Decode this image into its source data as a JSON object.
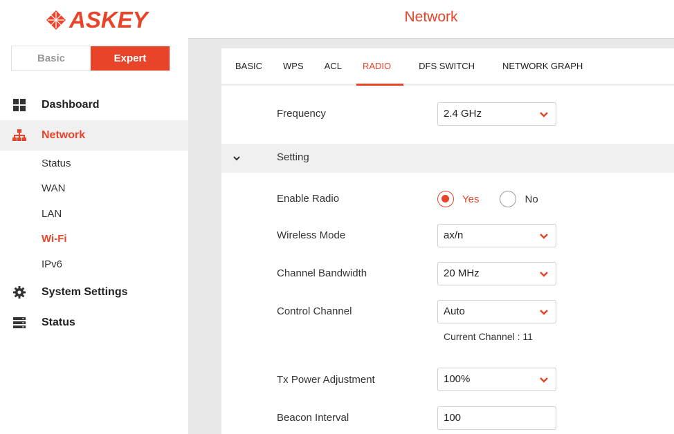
{
  "brand": {
    "name": "ASKEY",
    "color": "#e8442a"
  },
  "header": {
    "title": "Network"
  },
  "mode_toggle": {
    "basic_label": "Basic",
    "expert_label": "Expert",
    "selected": "Expert"
  },
  "sidebar": {
    "items": [
      {
        "label": "Dashboard",
        "icon": "dashboard-grid-icon"
      },
      {
        "label": "Network",
        "icon": "network-icon",
        "active": true
      },
      {
        "label": "System Settings",
        "icon": "gear-icon"
      },
      {
        "label": "Status",
        "icon": "server-icon"
      }
    ],
    "network_sub": [
      {
        "label": "Status"
      },
      {
        "label": "WAN"
      },
      {
        "label": "LAN"
      },
      {
        "label": "Wi-Fi",
        "active": true
      },
      {
        "label": "IPv6"
      }
    ]
  },
  "tabs": [
    {
      "label": "BASIC"
    },
    {
      "label": "WPS"
    },
    {
      "label": "ACL"
    },
    {
      "label": "RADIO",
      "active": true
    },
    {
      "label": "DFS SWITCH"
    },
    {
      "label": "NETWORK GRAPH"
    }
  ],
  "form": {
    "frequency": {
      "label": "Frequency",
      "value": "2.4 GHz"
    },
    "setting_section": {
      "label": "Setting"
    },
    "enable_radio": {
      "label": "Enable Radio",
      "yes_label": "Yes",
      "no_label": "No",
      "selected": "Yes"
    },
    "wireless_mode": {
      "label": "Wireless Mode",
      "value": "ax/n"
    },
    "channel_bandwidth": {
      "label": "Channel Bandwidth",
      "value": "20 MHz"
    },
    "control_channel": {
      "label": "Control Channel",
      "value": "Auto",
      "current_channel_text": "Current Channel : 11"
    },
    "tx_power": {
      "label": "Tx Power Adjustment",
      "value": "100%"
    },
    "beacon_interval": {
      "label": "Beacon Interval",
      "value": "100"
    }
  }
}
